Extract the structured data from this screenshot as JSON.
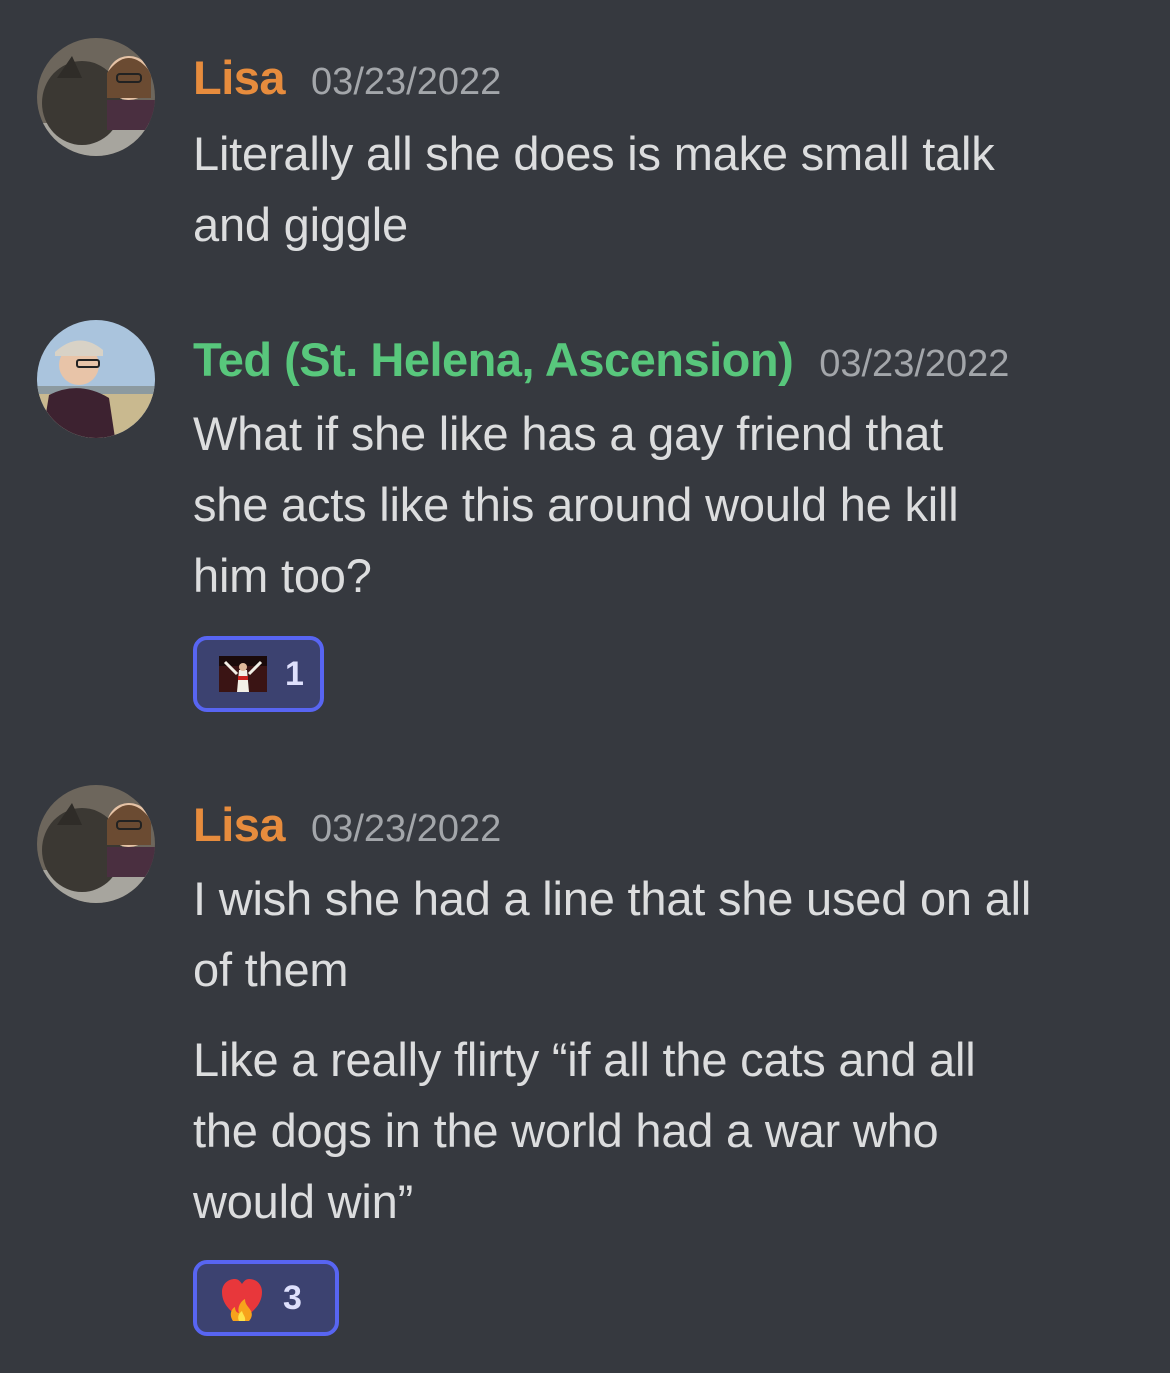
{
  "messages": [
    {
      "author": "Lisa",
      "author_color": "#e78c3d",
      "timestamp": "03/23/2022",
      "lines": [
        "Literally all she does is make small talk",
        "and giggle"
      ]
    },
    {
      "author": "Ted (St. Helena, Ascension)",
      "author_color": "#58c77c",
      "timestamp": "03/23/2022",
      "lines": [
        "What if she like has a gay friend that",
        "she acts like this around would he kill",
        "him too?"
      ],
      "reaction": {
        "icon": "pope-emoji-icon",
        "count": "1"
      }
    },
    {
      "author": "Lisa",
      "author_color": "#e78c3d",
      "timestamp": "03/23/2022",
      "lines": [
        "I wish she had a line that she used on all",
        "of them"
      ],
      "followup_lines": [
        "Like a really flirty “if all the cats and all",
        "the dogs in the world had a war who",
        "would win”"
      ],
      "reaction": {
        "icon": "heart-on-fire-icon",
        "count": "3"
      }
    }
  ]
}
